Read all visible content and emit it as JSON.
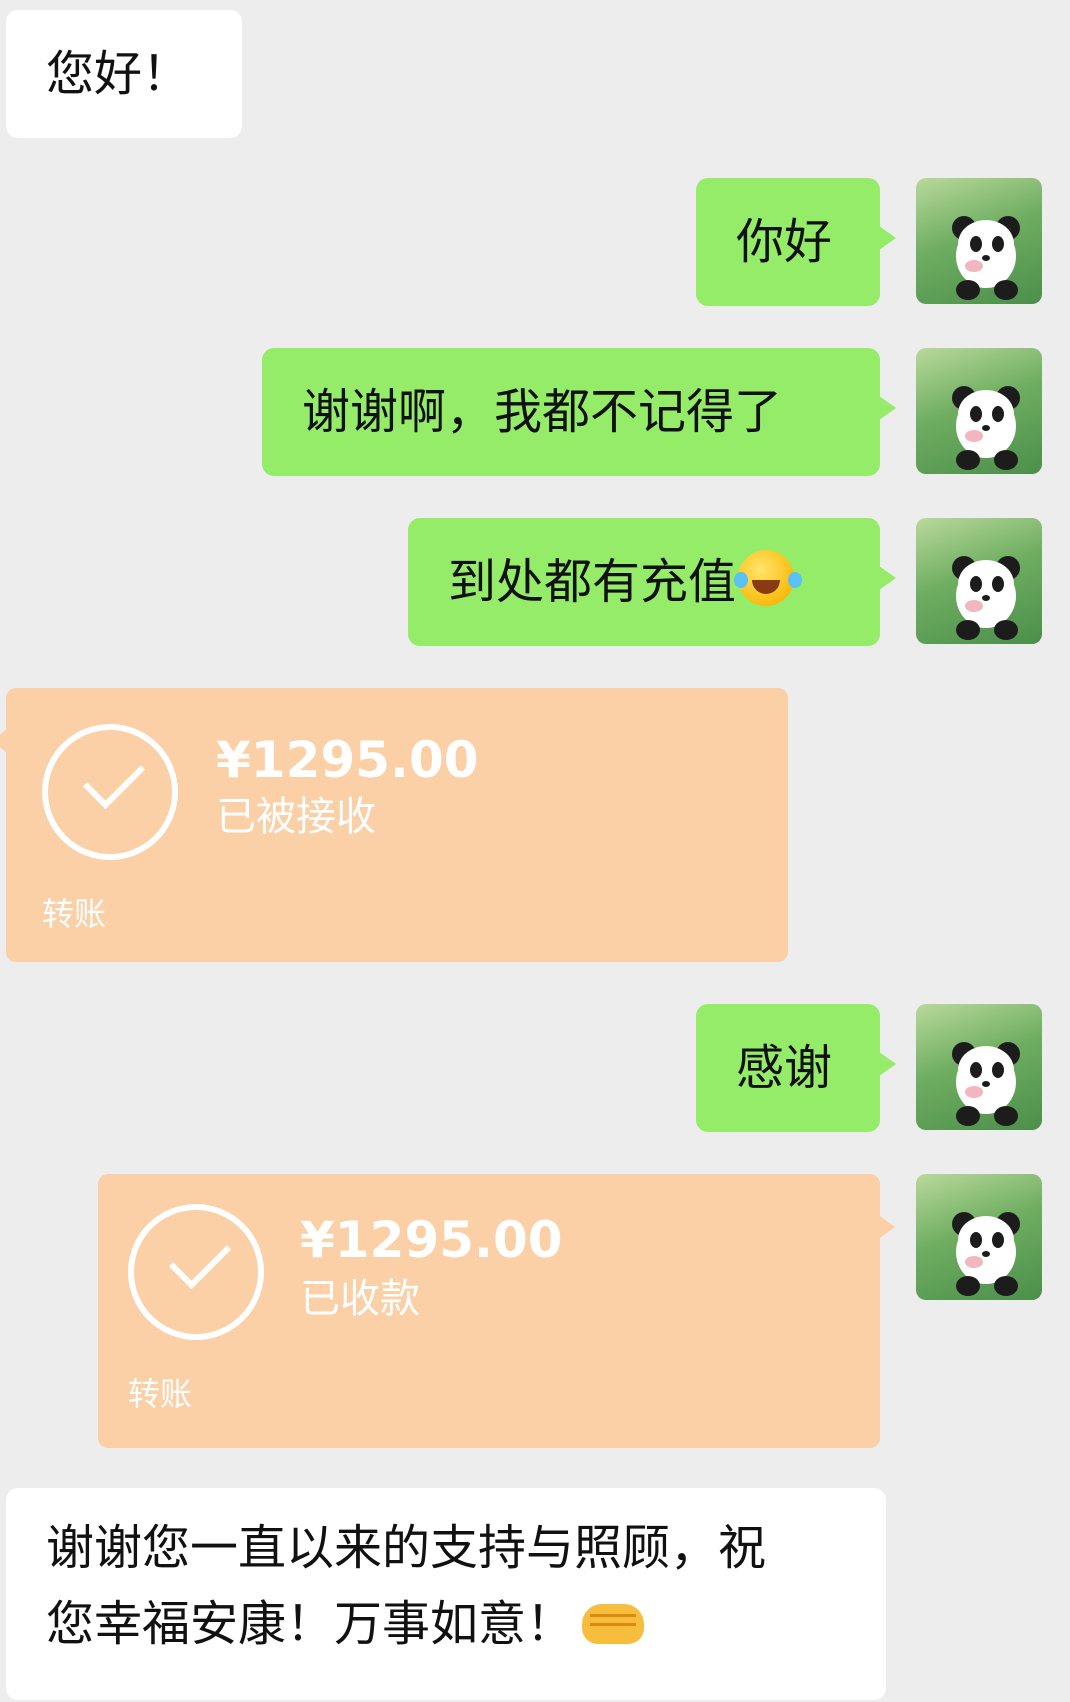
{
  "messages": {
    "m1": "您好！",
    "m2": "你好",
    "m3": "谢谢啊，我都不记得了",
    "m4": "到处都有充值",
    "m4_emoji": "tears-of-joy-emoji",
    "t1": {
      "amount": "¥1295.00",
      "status": "已被接收",
      "label": "转账"
    },
    "m5": "感谢",
    "t2": {
      "amount": "¥1295.00",
      "status": "已收款",
      "label": "转账"
    },
    "m6_line1": "谢谢您一直以来的支持与照顾，祝",
    "m6_line2": "您幸福安康！万事如意！",
    "m6_emoji": "handshake-emoji"
  },
  "colors": {
    "background": "#ededed",
    "incoming_bubble": "#ffffff",
    "outgoing_bubble": "#95ec69",
    "transfer_card": "#fbd0a6"
  },
  "avatar": {
    "icon": "panda-avatar-icon"
  }
}
